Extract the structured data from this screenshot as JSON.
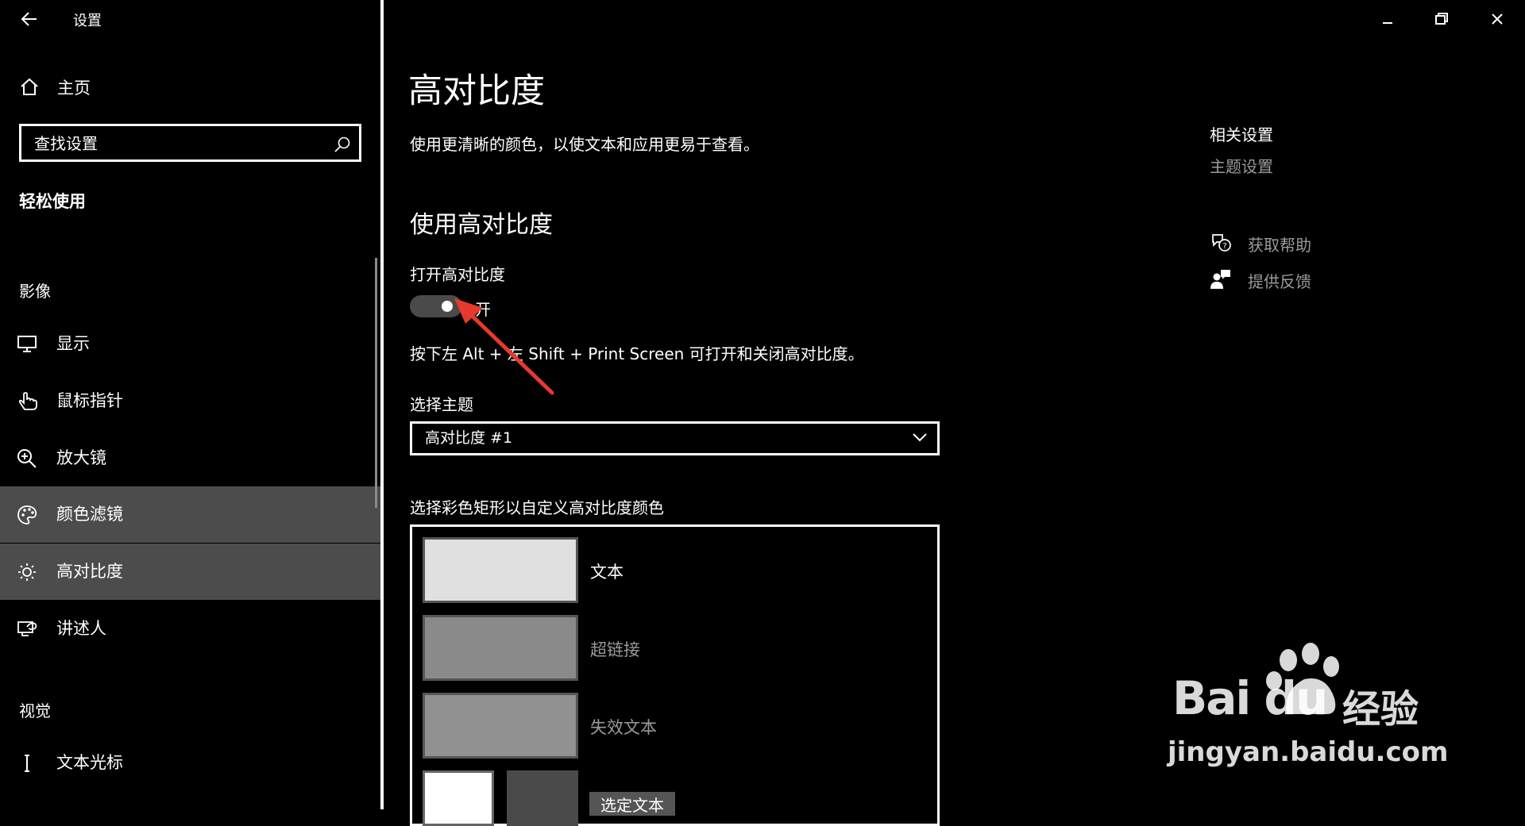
{
  "window": {
    "title": "设置",
    "controls": {
      "minimize": "—",
      "maximize": "⧉",
      "close": "✕"
    }
  },
  "sidebar": {
    "home_label": "主页",
    "search_placeholder": "查找设置",
    "category": "轻松使用",
    "sections": [
      {
        "title": "影像",
        "items": [
          {
            "label": "显示",
            "icon": "monitor-icon",
            "selected": false
          },
          {
            "label": "鼠标指针",
            "icon": "pointer-hand-icon",
            "selected": false
          },
          {
            "label": "放大镜",
            "icon": "magnifier-icon",
            "selected": false
          },
          {
            "label": "颜色滤镜",
            "icon": "palette-icon",
            "selected": true
          },
          {
            "label": "高对比度",
            "icon": "sun-icon",
            "selected": true
          },
          {
            "label": "讲述人",
            "icon": "narrator-icon",
            "selected": false
          }
        ]
      },
      {
        "title": "视觉",
        "items": [
          {
            "label": "文本光标",
            "icon": "text-cursor-icon",
            "selected": false
          }
        ]
      }
    ]
  },
  "main": {
    "title": "高对比度",
    "description": "使用更清晰的颜色，以使文本和应用更易于查看。",
    "section_title": "使用高对比度",
    "toggle_label": "打开高对比度",
    "toggle_state": "开",
    "toggle_on": true,
    "shortcut_text": "按下左 Alt + 左 Shift + Print Screen 可打开和关闭高对比度。",
    "theme_label": "选择主题",
    "theme_value": "高对比度 #1",
    "customize_label": "选择彩色矩形以自定义高对比度颜色",
    "swatches": [
      {
        "label": "文本",
        "color": "#e0e0e0",
        "label_color": "#ffffff"
      },
      {
        "label": "超链接",
        "color": "#8a8a8a",
        "label_color": "#9a9a9a"
      },
      {
        "label": "失效文本",
        "color": "#919191",
        "label_color": "#9a9a9a"
      }
    ],
    "selected_text": {
      "label": "选定文本",
      "foreground_color": "#ffffff",
      "background_color": "#4a4a4a"
    }
  },
  "related": {
    "title": "相关设置",
    "theme_settings_link": "主题设置",
    "get_help": "获取帮助",
    "feedback": "提供反馈"
  },
  "watermark": {
    "brand": "Bai du",
    "brand_cn": "经验",
    "url": "jingyan.baidu.com"
  },
  "annotation": {
    "arrow_color": "#e8392f"
  }
}
